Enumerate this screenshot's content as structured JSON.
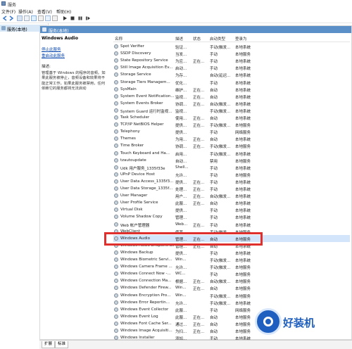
{
  "window": {
    "title": "服务"
  },
  "menu": [
    "文件(F)",
    "操作(A)",
    "查看(V)",
    "帮助(H)"
  ],
  "tree": {
    "root_label": "服务(本地)"
  },
  "panel": {
    "header": "服务(本地)"
  },
  "detail": {
    "service_name": "Windows Audio",
    "stop_link": "停止此服务",
    "restart_link": "重启动此服务",
    "desc_label": "描述:",
    "desc_text": "管理基于 Windows 的程序的音频。如果此服务被停止，音频设备和效果将不能正常工作。如果此服务被禁用，任何依赖它的服务都将无法启动"
  },
  "columns": [
    "名称",
    "描述",
    "状态",
    "启动类型",
    "登录为"
  ],
  "services": [
    [
      "Spot Verifier",
      "验证...",
      "",
      "手动(触发...",
      "本地系统"
    ],
    [
      "SSDP Discovery",
      "当发...",
      "",
      "手动",
      "本地服务"
    ],
    [
      "State Repository Service",
      "为应...",
      "正在...",
      "手动",
      "本地系统"
    ],
    [
      "Still Image Acquisition Ev...",
      "启动...",
      "",
      "手动",
      "本地系统"
    ],
    [
      "Storage Service",
      "为存...",
      "",
      "自动(延迟...",
      "本地系统"
    ],
    [
      "Storage Tiers Managem...",
      "优化...",
      "",
      "手动",
      "本地系统"
    ],
    [
      "SysMain",
      "维护...",
      "正在...",
      "自动",
      "本地系统"
    ],
    [
      "System Event Notification...",
      "监视...",
      "正在...",
      "自动",
      "本地系统"
    ],
    [
      "System Events Broker",
      "协调...",
      "正在...",
      "自动(触发...",
      "本地系统"
    ],
    [
      "System Guard 运行时监视...",
      "监视...",
      "",
      "手动(触发...",
      "本地系统"
    ],
    [
      "Task Scheduler",
      "使用...",
      "正在...",
      "自动",
      "本地系统"
    ],
    [
      "TCP/IP NetBIOS Helper",
      "提供...",
      "正在...",
      "手动(触发...",
      "本地服务"
    ],
    [
      "Telephony",
      "提供...",
      "",
      "手动",
      "网络服务"
    ],
    [
      "Themes",
      "为用...",
      "正在...",
      "自动",
      "本地系统"
    ],
    [
      "Time Broker",
      "协调...",
      "正在...",
      "手动(触发...",
      "本地服务"
    ],
    [
      "Touch Keyboard and Ha...",
      "启用...",
      "",
      "手动(触发...",
      "本地系统"
    ],
    [
      "tzautoupdate",
      "自动...",
      "",
      "禁用",
      "本地服务"
    ],
    [
      "Udk 用户服务_1335f33e",
      "Shell...",
      "",
      "手动",
      "本地系统"
    ],
    [
      "UPnP Device Host",
      "允许...",
      "",
      "手动",
      "本地服务"
    ],
    [
      "User Data Access_1335f3...",
      "提供...",
      "正在...",
      "手动",
      "本地系统"
    ],
    [
      "User Data Storage_1335f...",
      "处理...",
      "正在...",
      "手动",
      "本地系统"
    ],
    [
      "User Manager",
      "用户...",
      "正在...",
      "自动(触发...",
      "本地系统"
    ],
    [
      "User Profile Service",
      "此服...",
      "正在...",
      "自动",
      "本地系统"
    ],
    [
      "Virtual Disk",
      "提供...",
      "",
      "手动",
      "本地系统"
    ],
    [
      "Volume Shadow Copy",
      "管理...",
      "",
      "手动",
      "本地系统"
    ],
    [
      "Web 帐户管理器",
      "Web...",
      "正在...",
      "手动",
      "本地系统"
    ],
    [
      "WebClient",
      "使基...",
      "",
      "手动(触发...",
      "本地服务"
    ],
    [
      "Windows Audio",
      "管理...",
      "正在...",
      "自动",
      "本地服务"
    ],
    [
      "Windows Audio Endpoint Builder",
      "管理...",
      "正在...",
      "自动",
      "本地系统"
    ],
    [
      "Windows Backup",
      "提供...",
      "",
      "手动",
      "本地系统"
    ],
    [
      "Windows Biometric Servi...",
      "Win...",
      "",
      "手动(触发...",
      "本地系统"
    ],
    [
      "Windows Camera Frame ...",
      "允许...",
      "",
      "手动(触发...",
      "本地服务"
    ],
    [
      "Windows Connect Now -...",
      "WC...",
      "",
      "手动",
      "本地服务"
    ],
    [
      "Windows Connection Ma...",
      "根据...",
      "正在...",
      "自动(触发...",
      "本地服务"
    ],
    [
      "Windows Defender Firew...",
      "Win...",
      "正在...",
      "自动",
      "本地服务"
    ],
    [
      "Windows Encryption Pro...",
      "Win...",
      "",
      "手动(触发...",
      "本地服务"
    ],
    [
      "Windows Error Reportin...",
      "允许...",
      "",
      "手动(触发...",
      "本地系统"
    ],
    [
      "Windows Event Collector",
      "此服...",
      "",
      "手动",
      "网络服务"
    ],
    [
      "Windows Event Log",
      "此服...",
      "正在...",
      "自动",
      "本地服务"
    ],
    [
      "Windows Font Cache Ser...",
      "通过...",
      "正在...",
      "自动",
      "本地服务"
    ],
    [
      "Windows Image Acquisiti...",
      "为扫...",
      "正在...",
      "自动",
      "本地服务"
    ],
    [
      "Windows Installer",
      "添加...",
      "",
      "手动",
      "本地系统"
    ]
  ],
  "selected_index": 27,
  "tabs": [
    "扩展",
    "标准"
  ],
  "watermark": "好装机"
}
